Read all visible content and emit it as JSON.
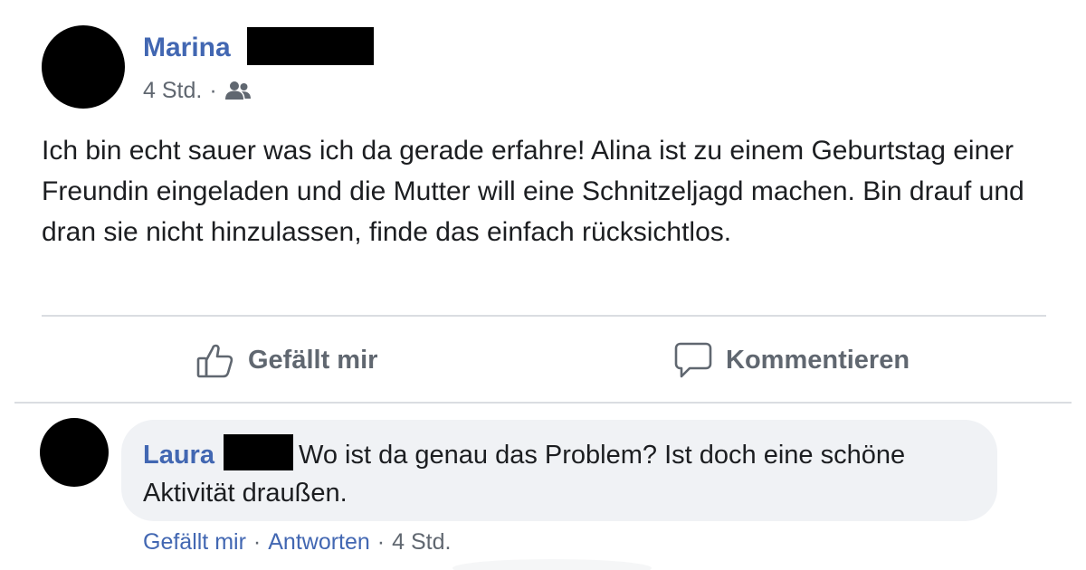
{
  "post": {
    "author": "Marina",
    "time": "4 Std.",
    "separator": "·",
    "audience_icon": "friends-icon",
    "text": "Ich bin echt sauer was ich da gerade erfahre! Alina ist zu einem Geburtstag einer Freundin eingeladen und die Mutter will eine Schnitzeljagd machen. Bin drauf und dran sie nicht hinzulassen, finde das einfach rücksichtlos."
  },
  "actions": {
    "like_label": "Gefällt mir",
    "comment_label": "Kommentieren"
  },
  "comment": {
    "author": "Laura",
    "text": "Wo ist da genau das Problem? Ist doch eine schöne Aktivität draußen.",
    "like_label": "Gefällt mir",
    "reply_label": "Antworten",
    "time": "4 Std.",
    "separator": "·"
  },
  "colors": {
    "link_blue": "#4267b2",
    "secondary_text": "#606770",
    "bubble_bg": "#f0f2f5",
    "divider": "#dadde1"
  }
}
